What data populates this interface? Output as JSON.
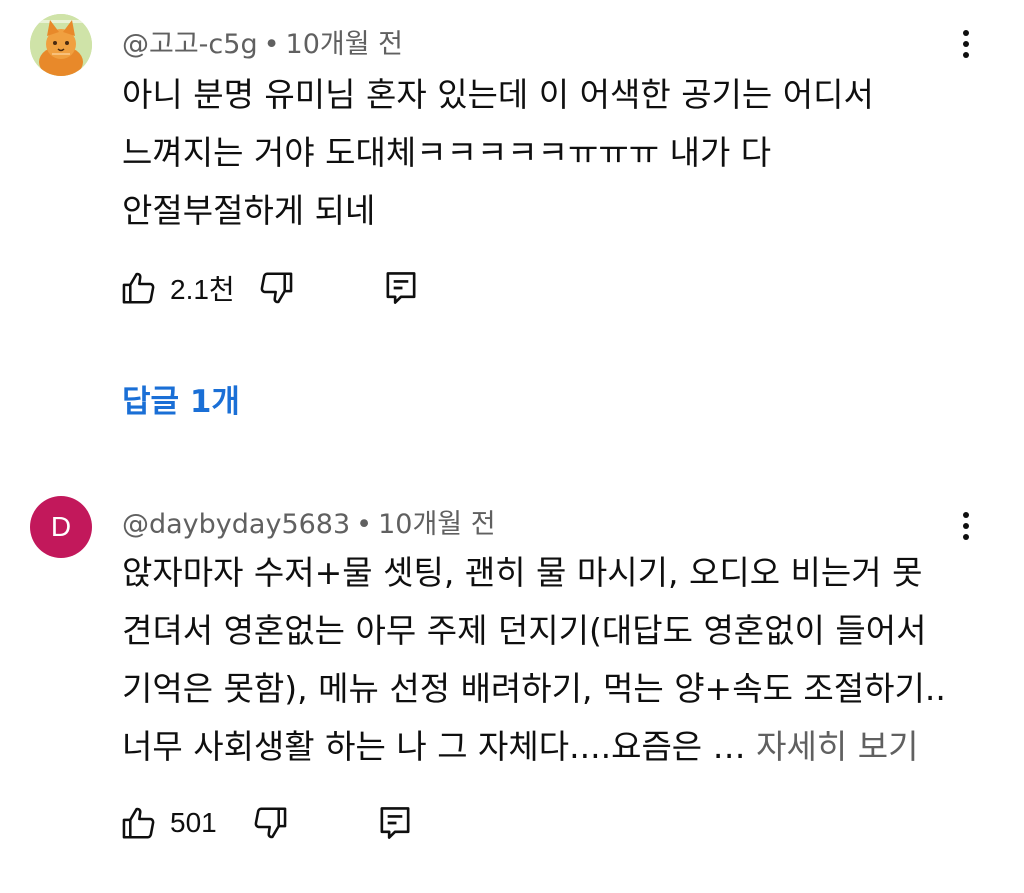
{
  "comments": [
    {
      "author": "@고고-c5g",
      "separator": "•",
      "time": "10개월 전",
      "lines": [
        "아니 분명 유미님 혼자 있는데 이 어색한 공기는 어디서",
        "느껴지는 거야 도대체ㅋㅋㅋㅋㅋㅠㅠㅠ 내가 다",
        "안절부절하게 되네"
      ],
      "likes": "2.1천",
      "avatar_letter": "",
      "icons": [
        "more-vert-icon",
        "thumb-up-icon",
        "thumb-down-icon",
        "reply-icon"
      ]
    },
    {
      "author": "@daybyday5683",
      "separator": "•",
      "time": "10개월 전",
      "lines": [
        "앉자마자 수저+물 셋팅, 괜히 물 마시기, 오디오 비는거 못",
        "견뎌서 영혼없는 아무 주제 던지기(대답도 영혼없이 들어서",
        "기억은 못함), 메뉴 선정 배려하기, 먹는 양+속도 조절하기..",
        "너무 사회생활 하는 나 그 자체다....요즘은 … "
      ],
      "read_more": "자세히 보기",
      "likes": "501",
      "avatar_letter": "D",
      "icons": [
        "more-vert-icon",
        "thumb-up-icon",
        "thumb-down-icon",
        "reply-icon"
      ]
    }
  ],
  "replies_link": "답글 1개",
  "colors": {
    "text": "#0f0f0f",
    "meta": "#606060",
    "link": "#1a6fd6",
    "avatar_d": "#c2185b"
  }
}
